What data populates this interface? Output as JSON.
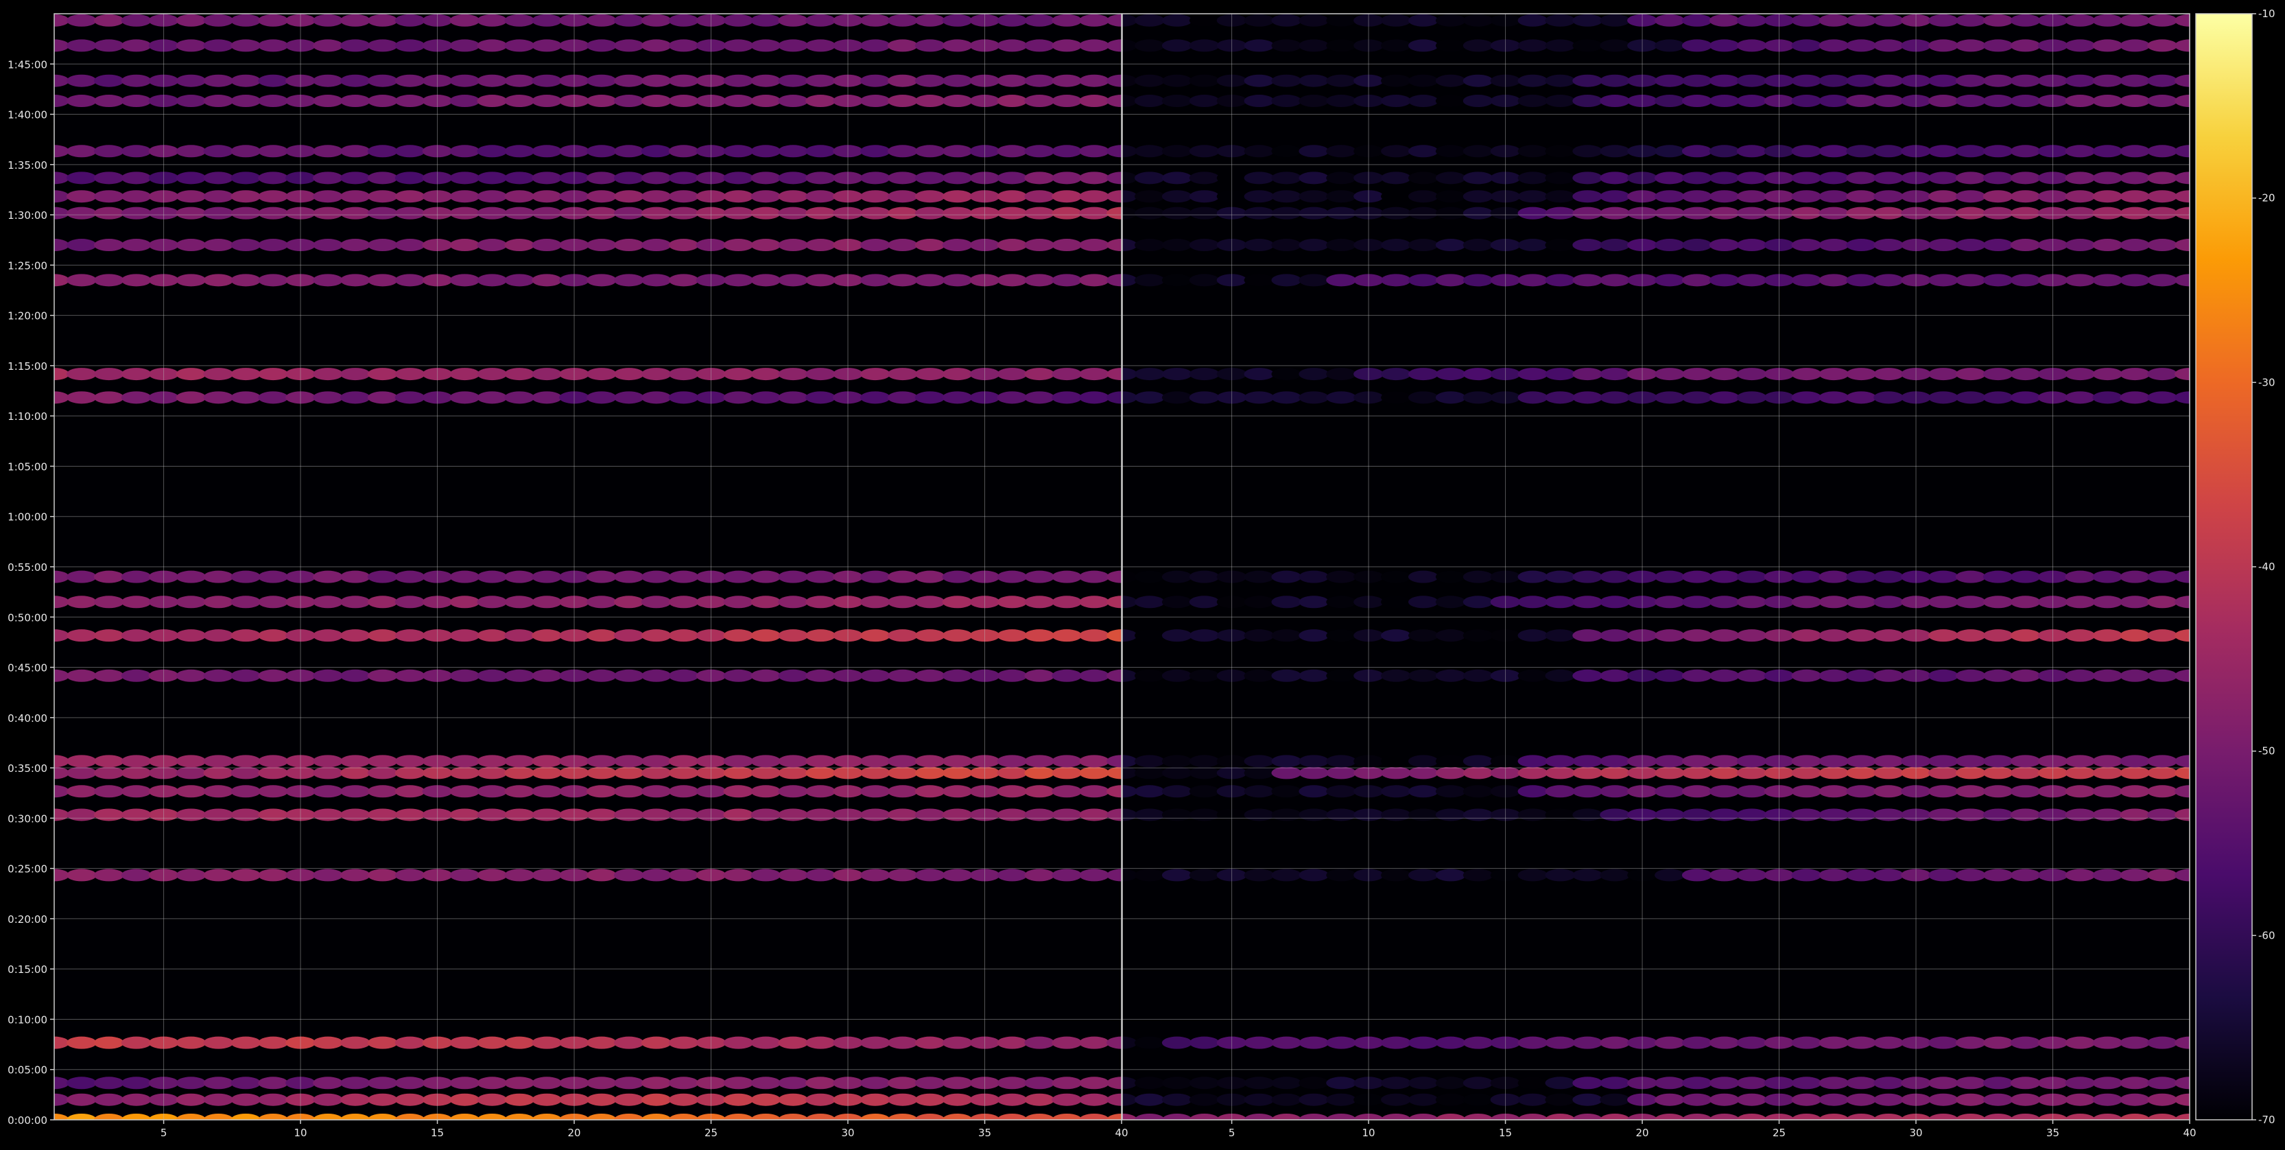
{
  "chart_data": {
    "type": "heatmap",
    "mark": "ellipse",
    "panels": 2,
    "x_range": [
      1,
      40
    ],
    "x_ticks": [
      "5",
      "10",
      "15",
      "20",
      "25",
      "30",
      "35",
      "40"
    ],
    "y_range_seconds": [
      0,
      6600
    ],
    "y_ticks": [
      "0:00:00",
      "0:05:00",
      "0:10:00",
      "0:15:00",
      "0:20:00",
      "0:25:00",
      "0:30:00",
      "0:35:00",
      "0:40:00",
      "0:45:00",
      "0:50:00",
      "0:55:00",
      "1:00:00",
      "1:05:00",
      "1:10:00",
      "1:15:00",
      "1:20:00",
      "1:25:00",
      "1:30:00",
      "1:35:00",
      "1:40:00",
      "1:45:00"
    ],
    "grid": true,
    "colormap": "inferno",
    "colorbar": {
      "range": [
        -70,
        -10
      ],
      "ticks": [
        "-10",
        "-20",
        "-30",
        "-40",
        "-50",
        "-60",
        "-70"
      ],
      "stops": [
        "#000004",
        "#1b0c41",
        "#4a0c6b",
        "#781c6d",
        "#a52c60",
        "#cf4446",
        "#ed6925",
        "#fb9b06",
        "#f7d13d",
        "#fcffa4"
      ]
    },
    "rows": [
      {
        "t": 0,
        "left": [
          -24,
          -28,
          -36
        ],
        "right": [
          -48,
          -45,
          -40
        ],
        "right_start": 1
      },
      {
        "t": 120,
        "left": [
          -50,
          -38,
          -44
        ],
        "right": [
          -70,
          -52,
          -48
        ],
        "right_start": 20
      },
      {
        "t": 220,
        "left": [
          -55,
          -48,
          -48
        ],
        "right": [
          -70,
          -55,
          -50
        ],
        "right_start": 18
      },
      {
        "t": 460,
        "left": [
          -38,
          -40,
          -48
        ],
        "right": [
          -58,
          -52,
          -50
        ],
        "right_start": 3
      },
      {
        "t": 1460,
        "left": [
          -48,
          -48,
          -50
        ],
        "right": [
          -70,
          -56,
          -50
        ],
        "right_start": 22
      },
      {
        "t": 1820,
        "left": [
          -44,
          -45,
          -46
        ],
        "right": [
          -70,
          -58,
          -48
        ],
        "right_start": 19
      },
      {
        "t": 1960,
        "left": [
          -48,
          -47,
          -46
        ],
        "right": [
          -70,
          -52,
          -48
        ],
        "right_start": 16
      },
      {
        "t": 2070,
        "left": [
          -48,
          -40,
          -36
        ],
        "right": [
          -60,
          -40,
          -38
        ],
        "right_start": 7
      },
      {
        "t": 2140,
        "left": [
          -44,
          -46,
          -48
        ],
        "right": [
          -70,
          -52,
          -50
        ],
        "right_start": 16
      },
      {
        "t": 2650,
        "left": [
          -50,
          -52,
          -52
        ],
        "right": [
          -70,
          -56,
          -52
        ],
        "right_start": 18
      },
      {
        "t": 2890,
        "left": [
          -44,
          -42,
          -36
        ],
        "right": [
          -70,
          -50,
          -38
        ],
        "right_start": 18
      },
      {
        "t": 3090,
        "left": [
          -48,
          -47,
          -44
        ],
        "right": [
          -70,
          -55,
          -48
        ],
        "right_start": 15
      },
      {
        "t": 3240,
        "left": [
          -50,
          -52,
          -50
        ],
        "right": [
          -70,
          -58,
          -54
        ],
        "right_start": 16
      },
      {
        "t": 4310,
        "left": [
          -48,
          -54,
          -56
        ],
        "right": [
          -70,
          -58,
          -56
        ],
        "right_start": 16
      },
      {
        "t": 4450,
        "left": [
          -44,
          -46,
          -48
        ],
        "right": [
          -70,
          -52,
          -50
        ],
        "right_start": 10
      },
      {
        "t": 5010,
        "left": [
          -48,
          -50,
          -50
        ],
        "right": [
          -58,
          -55,
          -52
        ],
        "right_start": 9
      },
      {
        "t": 5220,
        "left": [
          -52,
          -48,
          -48
        ],
        "right": [
          -70,
          -58,
          -50
        ],
        "right_start": 18
      },
      {
        "t": 5410,
        "left": [
          -50,
          -48,
          -42
        ],
        "right": [
          -70,
          -50,
          -44
        ],
        "right_start": 16
      },
      {
        "t": 5510,
        "left": [
          -50,
          -48,
          -44
        ],
        "right": [
          -70,
          -55,
          -46
        ],
        "right_start": 18
      },
      {
        "t": 5620,
        "left": [
          -56,
          -55,
          -50
        ],
        "right": [
          -70,
          -58,
          -50
        ],
        "right_start": 18
      },
      {
        "t": 5780,
        "left": [
          -52,
          -55,
          -54
        ],
        "right": [
          -70,
          -60,
          -54
        ],
        "right_start": 22
      },
      {
        "t": 6080,
        "left": [
          -52,
          -50,
          -48
        ],
        "right": [
          -70,
          -58,
          -50
        ],
        "right_start": 18
      },
      {
        "t": 6200,
        "left": [
          -54,
          -52,
          -50
        ],
        "right": [
          -70,
          -60,
          -52
        ],
        "right_start": 18
      },
      {
        "t": 6410,
        "left": [
          -52,
          -52,
          -50
        ],
        "right": [
          -70,
          -58,
          -50
        ],
        "right_start": 22
      },
      {
        "t": 6560,
        "left": [
          -50,
          -52,
          -52
        ],
        "right": [
          -70,
          -55,
          -50
        ],
        "right_start": 20
      }
    ]
  }
}
